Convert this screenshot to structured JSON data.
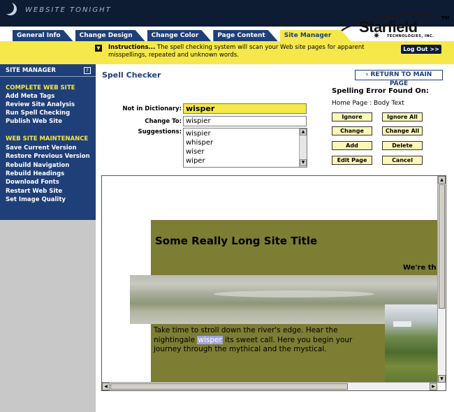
{
  "banner": {
    "brand": "WEBSITE TONIGHT"
  },
  "tabs": [
    {
      "label": "General Info"
    },
    {
      "label": "Change Design"
    },
    {
      "label": "Change Color"
    },
    {
      "label": "Page Content"
    },
    {
      "label": "Site Manager",
      "active": true
    }
  ],
  "logo": {
    "name": "Starfield",
    "tm": "TM",
    "sub": "TECHNOLOGIES, INC."
  },
  "instructions": {
    "lead": "Instructions...",
    "text": " The spell checking system will scan your Web site pages for apparent misspellings, repeated and unknown words."
  },
  "logout_label": "Log Out >>",
  "sidebar": {
    "title": "SITE MANAGER",
    "help": "?",
    "section1": "COMPLETE WEB SITE",
    "section1_items": [
      "Add Meta Tags",
      "Review Site Analysis",
      "Run Spell Checking",
      "Publish Web Site"
    ],
    "section2": "WEB SITE MAINTENANCE",
    "section2_items": [
      "Save Current Version",
      "Restore Previous Version",
      "Rebuild Navigation",
      "Rebuild Headings",
      "Download Fonts",
      "Restart Web Site",
      "Set Image Quality"
    ]
  },
  "spell": {
    "title": "Spell Checker",
    "return_label": "RETURN TO MAIN PAGE",
    "not_in_dict_label": "Not in Dictionary:",
    "not_in_dict_value": "wisper",
    "change_to_label": "Change To:",
    "change_to_value": "wispier",
    "suggestions_label": "Suggestions:",
    "suggestions": [
      "wispier",
      "whisper",
      "wiser",
      "wiper"
    ],
    "error_title": "Spelling Error Found On:",
    "error_location": "Home Page : Body Text",
    "buttons": {
      "ignore": "Ignore",
      "ignore_all": "Ignore All",
      "change": "Change",
      "change_all": "Change All",
      "add": "Add",
      "delete": "Delete",
      "edit_page": "Edit Page",
      "cancel": "Cancel"
    }
  },
  "preview": {
    "site_title": "Some Really Long Site Title",
    "tagline": "We're th",
    "body_before": "Take time to stroll down the river's edge. Hear the nightingale ",
    "body_highlight": "wisper",
    "body_after": " its sweet call. Here you begin your journey through the mythical and the mystical."
  },
  "colors": {
    "navy": "#1f3f78",
    "yellow": "#f6e84a",
    "olive": "#7d7d34"
  }
}
